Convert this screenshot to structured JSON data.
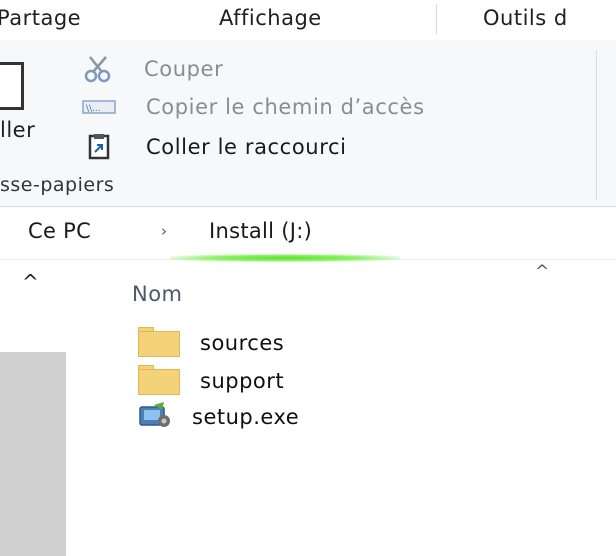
{
  "ribbon_tabs": [
    "Partage",
    "Affichage",
    "Outils d"
  ],
  "clipboard": {
    "paste_label": "ller",
    "cut_label": "Couper",
    "copy_path_label": "Copier le chemin d’accès",
    "paste_shortcut_label": "Coller le raccourci",
    "group_label": "sse-papiers"
  },
  "address": {
    "crumb_pc": "Ce PC",
    "separator": "›",
    "crumb_drive": "Install (J:)"
  },
  "file_list": {
    "column_name": "Nom",
    "sort_indicator": "^",
    "items": [
      {
        "name": "sources",
        "type": "folder"
      },
      {
        "name": "support",
        "type": "folder"
      },
      {
        "name": "setup.exe",
        "type": "exe"
      }
    ]
  },
  "nav_pane": {
    "collapse_arrow": "^"
  },
  "colors": {
    "folder": "#f4d27a",
    "highlight": "#58e22a",
    "disabled_text": "#8c8c8c"
  }
}
